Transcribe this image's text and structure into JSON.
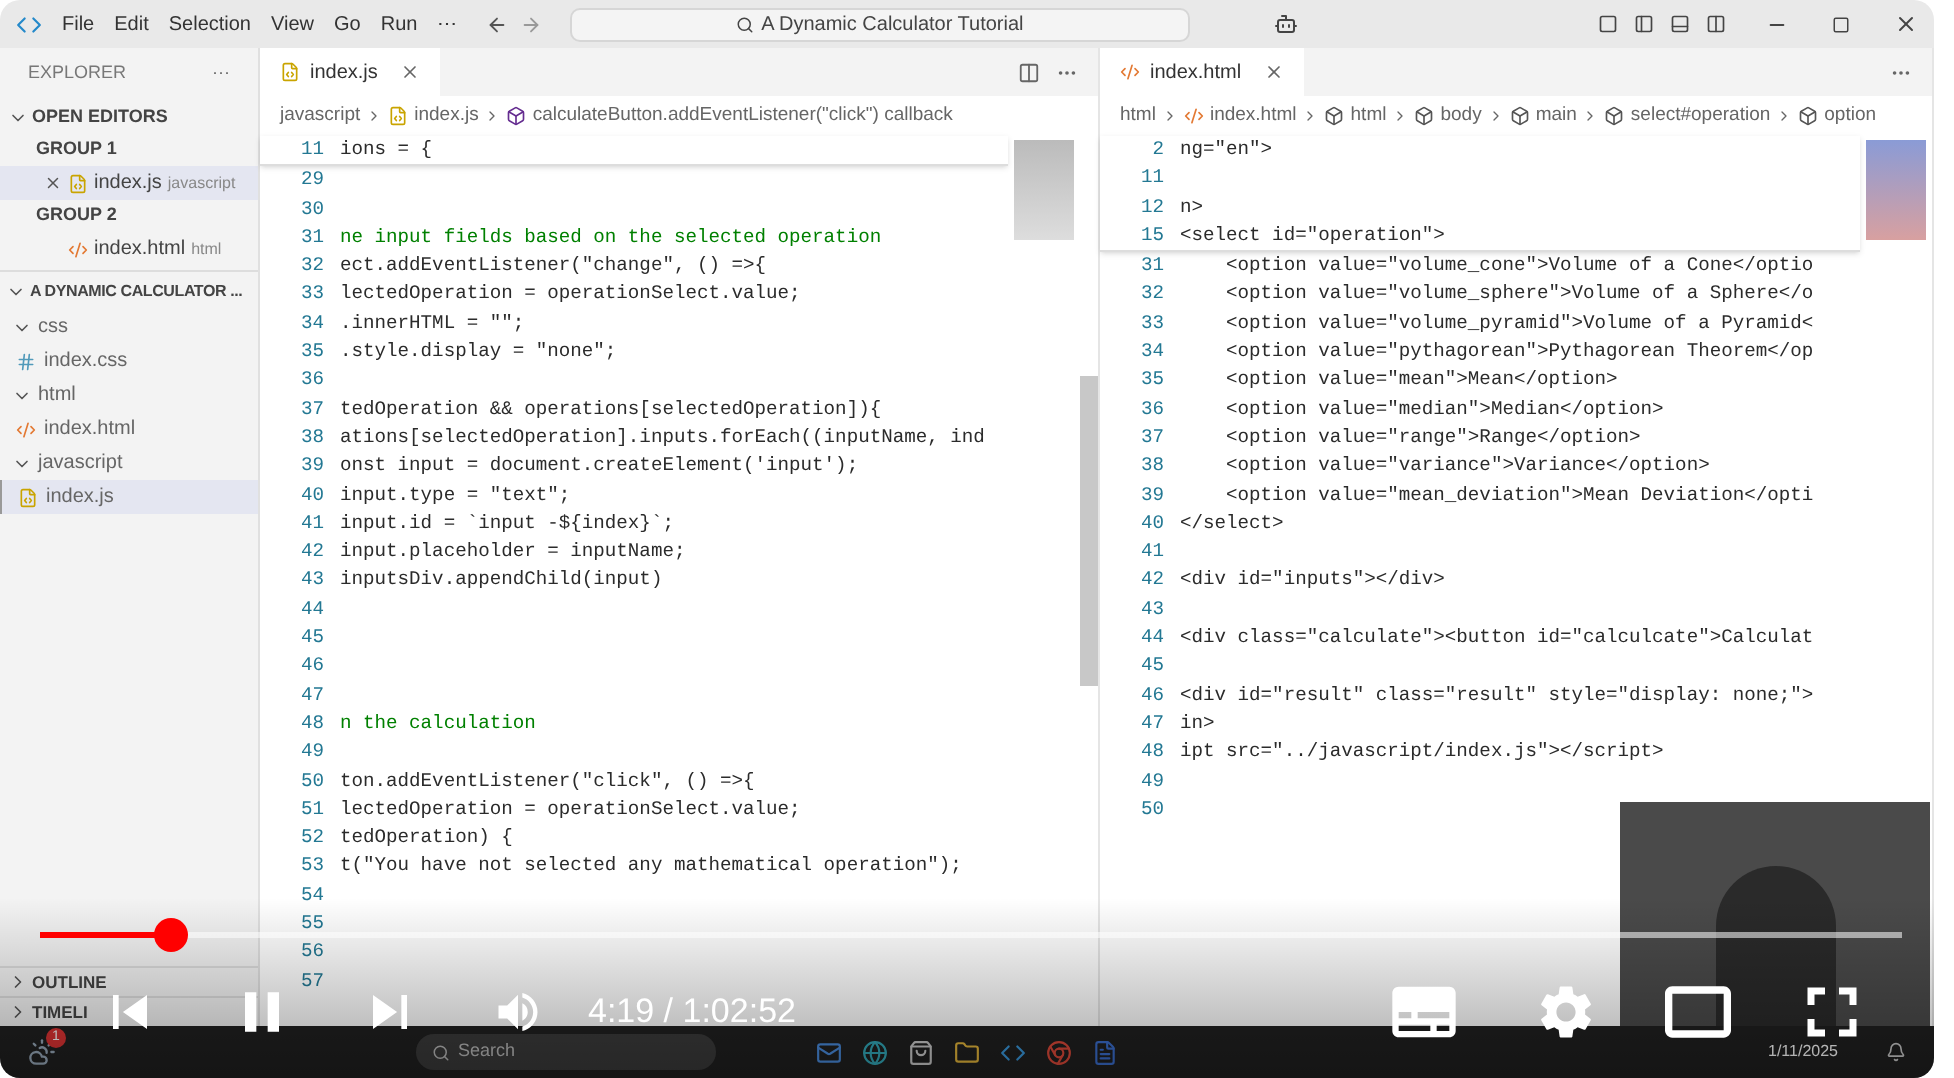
{
  "titlebar": {
    "menu": [
      "File",
      "Edit",
      "Selection",
      "View",
      "Go",
      "Run",
      "⋯"
    ],
    "search": "A Dynamic Calculator Tutorial"
  },
  "sidebar": {
    "title": "EXPLORER",
    "more": "···",
    "open_editors": {
      "label": "OPEN EDITORS",
      "expanded": true,
      "groups": [
        {
          "label": "GROUP 1",
          "items": [
            {
              "name": "index.js",
              "detail": "javascript",
              "kind": "js",
              "selected": true
            }
          ]
        },
        {
          "label": "GROUP 2",
          "items": [
            {
              "name": "index.html",
              "detail": "html",
              "kind": "html",
              "selected": false
            }
          ]
        }
      ]
    },
    "project": {
      "label": "A DYNAMIC CALCULATOR ...",
      "expanded": true,
      "children": [
        {
          "name": "css",
          "kind": "folder",
          "expanded": true,
          "selected": false,
          "children": [
            {
              "name": "index.css",
              "kind": "css",
              "selected": false
            }
          ]
        },
        {
          "name": "html",
          "kind": "folder",
          "expanded": true,
          "selected": false,
          "children": [
            {
              "name": "index.html",
              "kind": "html",
              "selected": false
            }
          ]
        },
        {
          "name": "javascript",
          "kind": "folder",
          "expanded": true,
          "selected": false,
          "children": [
            {
              "name": "index.js",
              "kind": "js",
              "selected": true
            }
          ]
        }
      ]
    },
    "bottom_sections": [
      "OUTLINE",
      "TIMELI"
    ]
  },
  "editors": [
    {
      "tab": {
        "label": "index.js",
        "kind": "js",
        "selected": true
      },
      "breadcrumbs": [
        {
          "label": "javascript",
          "kind": "folder"
        },
        {
          "label": "index.js",
          "kind": "js"
        },
        {
          "label": "calculateButton.addEventListener(\"click\") callback",
          "kind": "method"
        }
      ],
      "sticky": [
        {
          "num": "11",
          "text": "ions = {",
          "kind": "code"
        }
      ],
      "lines": [
        {
          "num": "29"
        },
        {
          "num": "30"
        },
        {
          "num": "31",
          "text": "ne input fields based on the selected operation",
          "kind": "comment"
        },
        {
          "num": "32",
          "text": "ect.addEventListener(\"change\", () =>{",
          "kind": "code"
        },
        {
          "num": "33",
          "text": "lectedOperation = operationSelect.value;",
          "kind": "code"
        },
        {
          "num": "34",
          "text": ".innerHTML = \"\";",
          "kind": "code"
        },
        {
          "num": "35",
          "text": ".style.display = \"none\";",
          "kind": "code"
        },
        {
          "num": "36"
        },
        {
          "num": "37",
          "text": "tedOperation && operations[selectedOperation]){",
          "kind": "code"
        },
        {
          "num": "38",
          "text": "ations[selectedOperation].inputs.forEach((inputName, ind",
          "kind": "code"
        },
        {
          "num": "39",
          "text": "onst input = document.createElement('input');",
          "kind": "code"
        },
        {
          "num": "40",
          "text": "input.type = \"text\";",
          "kind": "code"
        },
        {
          "num": "41",
          "text": "input.id = `input -${index}`;",
          "kind": "code"
        },
        {
          "num": "42",
          "text": "input.placeholder = inputName;",
          "kind": "code"
        },
        {
          "num": "43",
          "text": "inputsDiv.appendChild(input)",
          "kind": "code"
        },
        {
          "num": "44"
        },
        {
          "num": "45"
        },
        {
          "num": "46"
        },
        {
          "num": "47"
        },
        {
          "num": "48",
          "text": "n the calculation",
          "kind": "comment"
        },
        {
          "num": "49"
        },
        {
          "num": "50",
          "text": "ton.addEventListener(\"click\", () =>{",
          "kind": "code"
        },
        {
          "num": "51",
          "text": "lectedOperation = operationSelect.value;",
          "kind": "code"
        },
        {
          "num": "52",
          "text": "tedOperation) {",
          "kind": "code"
        },
        {
          "num": "53",
          "text": "t(\"You have not selected any mathematical operation\");",
          "kind": "code"
        },
        {
          "num": "54"
        },
        {
          "num": "55"
        },
        {
          "num": "56"
        },
        {
          "num": "57"
        }
      ]
    },
    {
      "tab": {
        "label": "index.html",
        "kind": "html",
        "selected": true
      },
      "breadcrumbs": [
        {
          "label": "html",
          "kind": "folder"
        },
        {
          "label": "index.html",
          "kind": "html"
        },
        {
          "label": "html",
          "kind": "symbol"
        },
        {
          "label": "body",
          "kind": "symbol"
        },
        {
          "label": "main",
          "kind": "symbol"
        },
        {
          "label": "select#operation",
          "kind": "symbol"
        },
        {
          "label": "option",
          "kind": "symbol"
        }
      ],
      "sticky": [
        {
          "num": "2",
          "text": "ng=\"en\">",
          "kind": "code"
        },
        {
          "num": "11"
        },
        {
          "num": "12",
          "text": "n>",
          "kind": "code"
        },
        {
          "num": "15",
          "text": "<select id=\"operation\">",
          "kind": "code"
        }
      ],
      "lines": [
        {
          "num": "31",
          "text": "    <option value=\"volume_cone\">Volume of a Cone</optio",
          "kind": "code"
        },
        {
          "num": "32",
          "text": "    <option value=\"volume_sphere\">Volume of a Sphere</o",
          "kind": "code"
        },
        {
          "num": "33",
          "text": "    <option value=\"volume_pyramid\">Volume of a Pyramid<",
          "kind": "code"
        },
        {
          "num": "34",
          "text": "    <option value=\"pythagorean\">Pythagorean Theorem</op",
          "kind": "code"
        },
        {
          "num": "35",
          "text": "    <option value=\"mean\">Mean</option>",
          "kind": "code"
        },
        {
          "num": "36",
          "text": "    <option value=\"median\">Median</option>",
          "kind": "code"
        },
        {
          "num": "37",
          "text": "    <option value=\"range\">Range</option>",
          "kind": "code"
        },
        {
          "num": "38",
          "text": "    <option value=\"variance\">Variance</option>",
          "kind": "code"
        },
        {
          "num": "39",
          "text": "    <option value=\"mean_deviation\">Mean Deviation</opti",
          "kind": "code"
        },
        {
          "num": "40",
          "text": "</select>",
          "kind": "code"
        },
        {
          "num": "41"
        },
        {
          "num": "42",
          "text": "<div id=\"inputs\"></div>",
          "kind": "code"
        },
        {
          "num": "43"
        },
        {
          "num": "44",
          "text": "<div class=\"calculate\"><button id=\"calculcate\">Calculat",
          "kind": "code"
        },
        {
          "num": "45"
        },
        {
          "num": "46",
          "text": "<div id=\"result\" class=\"result\" style=\"display: none;\">",
          "kind": "code"
        },
        {
          "num": "47",
          "text": "in>",
          "kind": "code"
        },
        {
          "num": "48",
          "text": "ipt src=\"../javascript/index.js\"></script>",
          "kind": "code"
        },
        {
          "num": "49"
        },
        {
          "num": "50"
        }
      ]
    }
  ],
  "taskbar": {
    "weather_badge": "1",
    "search": "Search",
    "date": "1/11/2025"
  },
  "player": {
    "progress": {
      "level": 0.07
    },
    "playing": true,
    "time": "4:19 / 1:02:52"
  }
}
